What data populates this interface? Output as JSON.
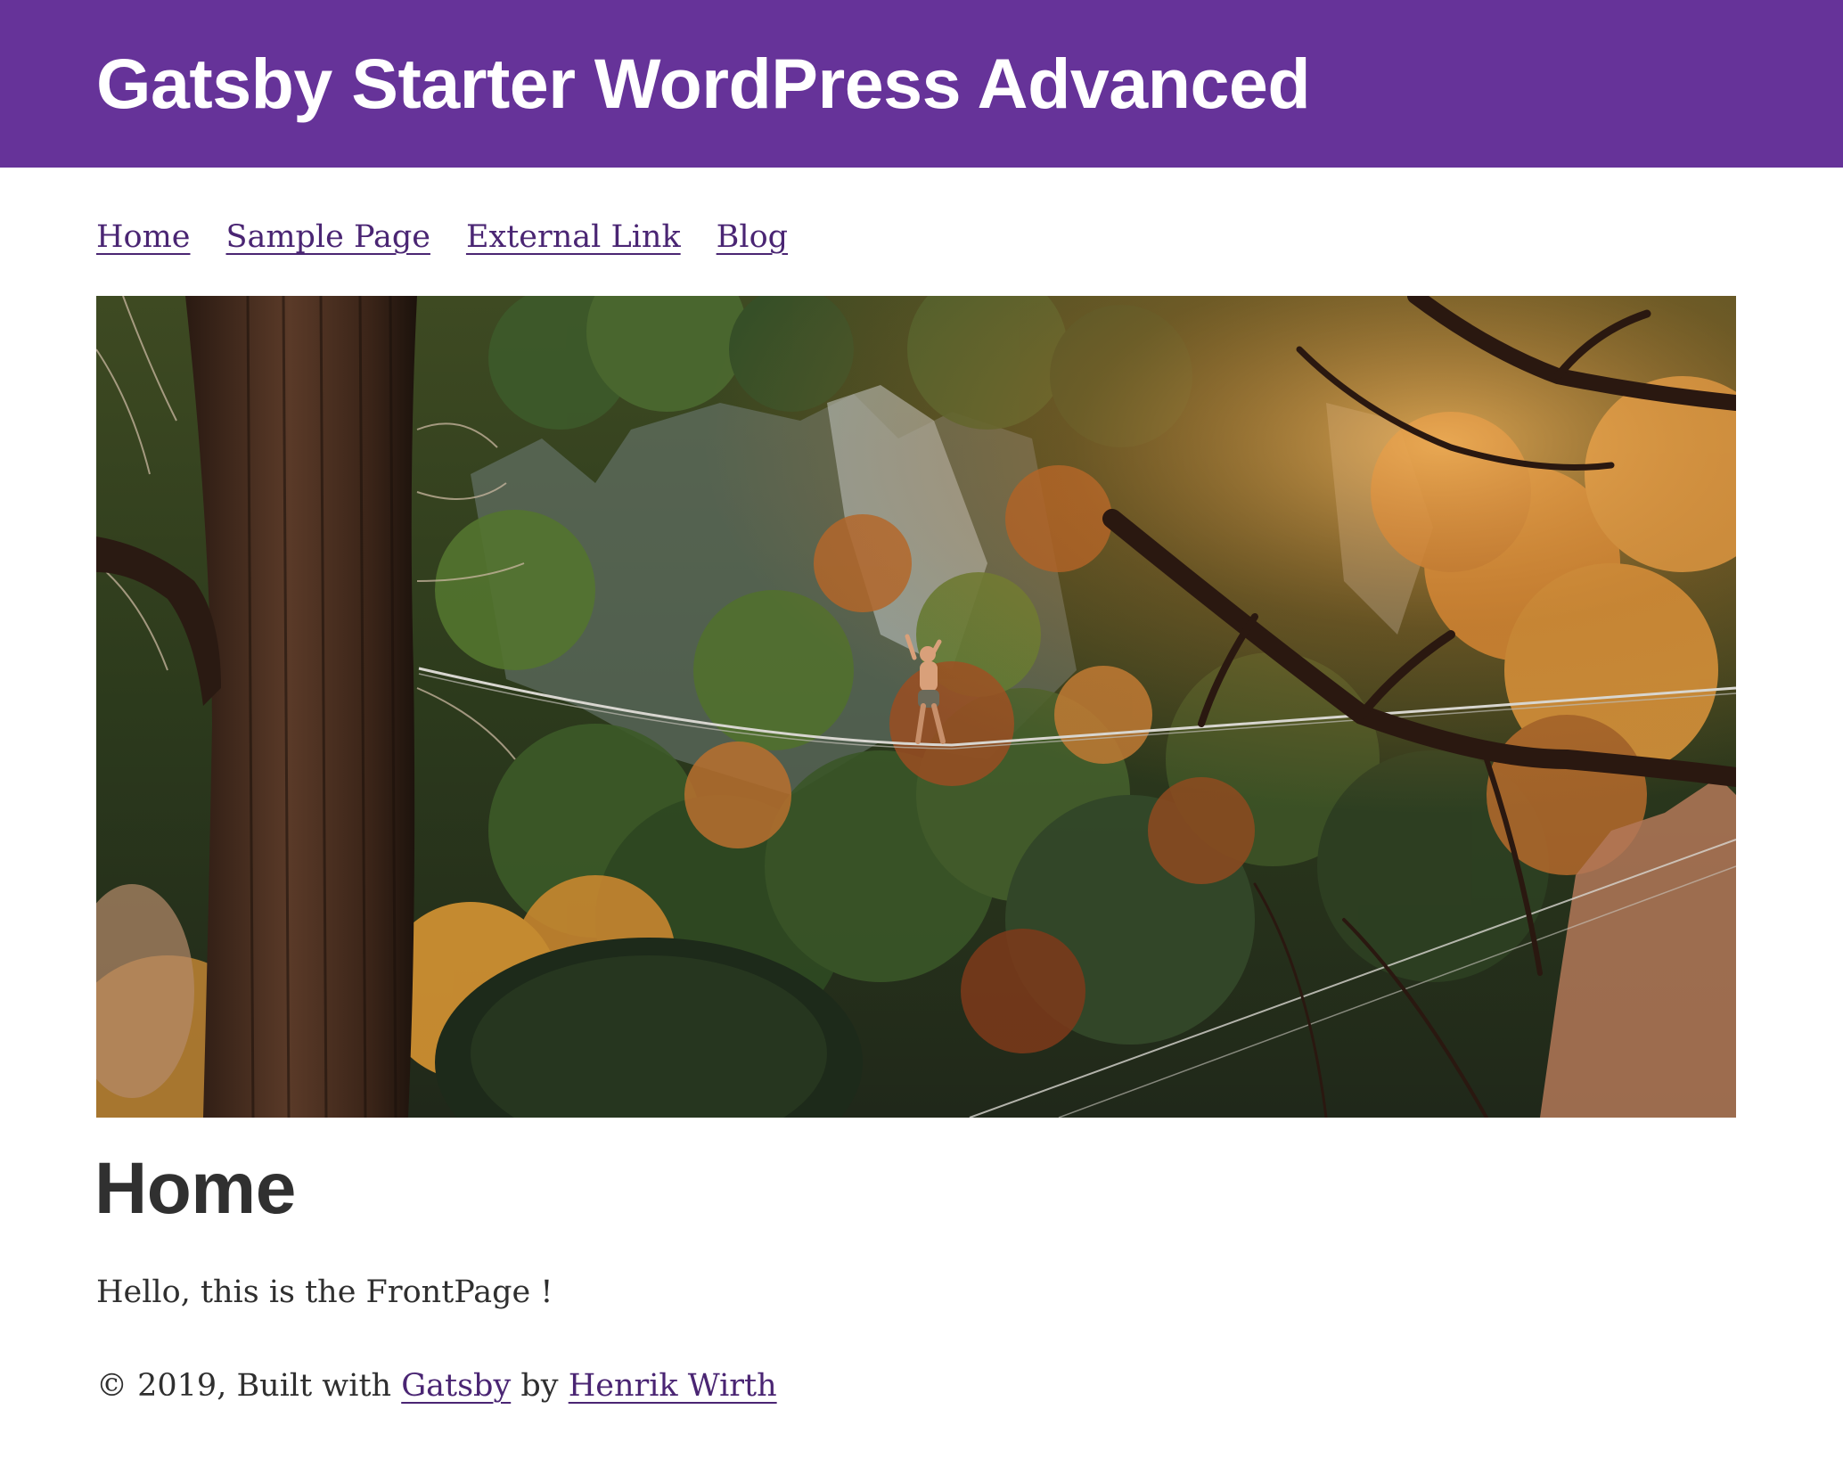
{
  "header": {
    "title": "Gatsby Starter WordPress Advanced",
    "background_color": "#663399"
  },
  "nav": {
    "items": [
      {
        "label": "Home"
      },
      {
        "label": "Sample Page"
      },
      {
        "label": "External Link"
      },
      {
        "label": "Blog"
      }
    ],
    "link_color": "#4a2573"
  },
  "hero": {
    "alt": "Slackliner walking a line between trees over an autumn forest canyon"
  },
  "page": {
    "title": "Home",
    "content": "Hello, this is the FrontPage !"
  },
  "footer": {
    "prefix": "© 2019, Built with",
    "gatsby_link": "Gatsby",
    "by_text": "by",
    "author_link": "Henrik Wirth"
  }
}
